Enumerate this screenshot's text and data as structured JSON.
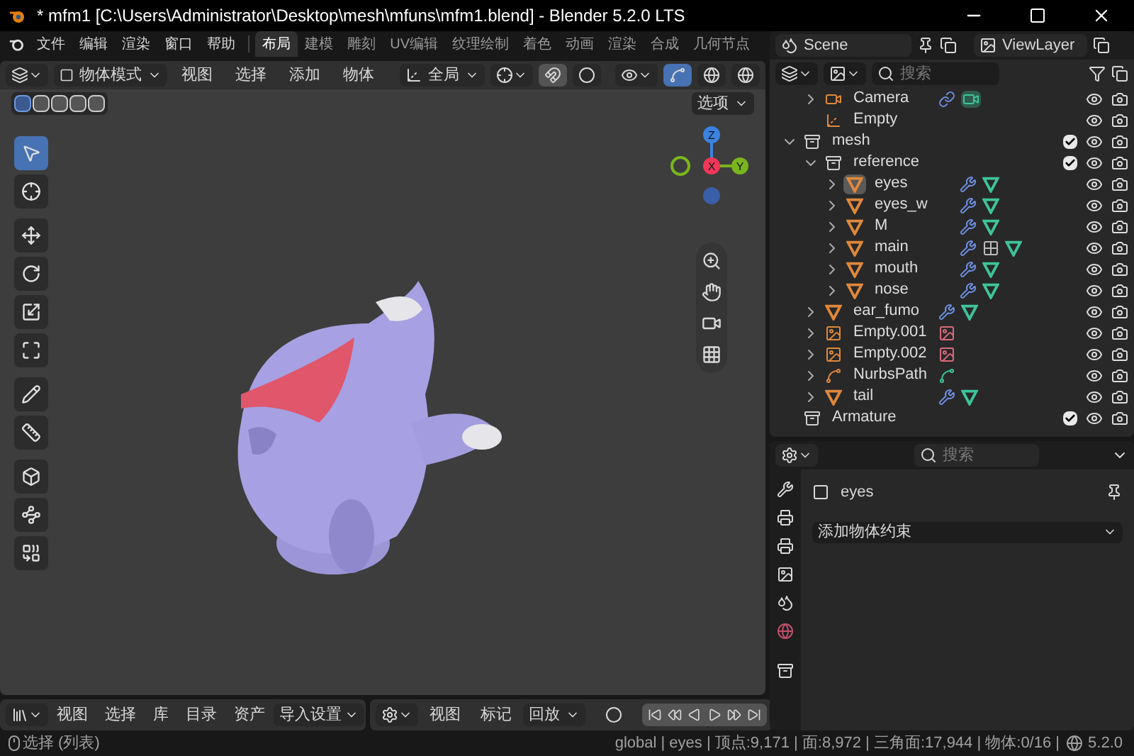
{
  "window": {
    "title": "* mfm1 [C:\\Users\\Administrator\\Desktop\\mesh\\mfuns\\mfm1.blend] - Blender 5.2.0 LTS"
  },
  "menu": [
    "文件",
    "编辑",
    "渲染",
    "窗口",
    "帮助"
  ],
  "workspaces": [
    {
      "label": "布局",
      "selected": true
    },
    {
      "label": "建模",
      "selected": false
    },
    {
      "label": "雕刻",
      "selected": false
    },
    {
      "label": "UV编辑",
      "selected": false
    },
    {
      "label": "纹理绘制",
      "selected": false
    },
    {
      "label": "着色",
      "selected": false
    },
    {
      "label": "动画",
      "selected": false
    },
    {
      "label": "渲染",
      "selected": false
    },
    {
      "label": "合成",
      "selected": false
    },
    {
      "label": "几何节点",
      "selected": false
    }
  ],
  "viewport_header": {
    "mode": "物体模式",
    "menus": [
      "视图",
      "选择",
      "添加",
      "物体"
    ],
    "orientation": "全局",
    "snap_on": false,
    "overlay_on": true
  },
  "viewport": {
    "options": "选项",
    "tools": [
      {
        "selected": true
      },
      {
        "selected": false
      },
      {
        "selected": false
      },
      {
        "selected": false
      },
      {
        "selected": false
      },
      {
        "selected": false
      },
      {
        "selected": false
      },
      {
        "selected": false
      },
      {
        "selected": false
      },
      {
        "selected": false
      },
      {
        "selected": false
      }
    ],
    "gizmo": {
      "x": "X",
      "y": "Y",
      "z": "Z"
    }
  },
  "outliner": {
    "scene": "Scene",
    "view_layer": "ViewLayer",
    "search": {
      "placeholder": "搜索"
    },
    "items": [
      {
        "name": "Camera",
        "kind": "camera",
        "expanded": false,
        "selected": false,
        "data": [
          {
            "kind": "constraint"
          },
          {
            "kind": "camera"
          }
        ]
      },
      {
        "name": "Empty",
        "kind": "empty",
        "selected": false
      },
      {
        "name": "mesh",
        "kind": "collection",
        "expanded": true,
        "checked": true,
        "selected": false,
        "children": [
          {
            "name": "reference",
            "kind": "collection",
            "expanded": true,
            "checked": true,
            "selected": false,
            "children": [
              {
                "name": "eyes",
                "kind": "mesh",
                "expanded": false,
                "selected": true,
                "data": [
                  {
                    "kind": "modifier"
                  },
                  {
                    "kind": "mesh"
                  }
                ]
              },
              {
                "name": "eyes_w",
                "kind": "mesh",
                "expanded": false,
                "selected": false,
                "data": [
                  {
                    "kind": "modifier"
                  },
                  {
                    "kind": "mesh"
                  }
                ]
              },
              {
                "name": "M",
                "kind": "mesh",
                "expanded": false,
                "selected": false,
                "data": [
                  {
                    "kind": "modifier"
                  },
                  {
                    "kind": "mesh"
                  }
                ]
              },
              {
                "name": "main",
                "kind": "mesh",
                "expanded": false,
                "selected": false,
                "data": [
                  {
                    "kind": "modifier"
                  },
                  {
                    "kind": "lattice"
                  },
                  {
                    "kind": "mesh"
                  }
                ]
              },
              {
                "name": "mouth",
                "kind": "mesh",
                "expanded": false,
                "selected": false,
                "data": [
                  {
                    "kind": "modifier"
                  },
                  {
                    "kind": "mesh"
                  }
                ]
              },
              {
                "name": "nose",
                "kind": "mesh",
                "expanded": false,
                "selected": false,
                "data": [
                  {
                    "kind": "modifier"
                  },
                  {
                    "kind": "mesh"
                  }
                ]
              }
            ]
          },
          {
            "name": "ear_fumo",
            "kind": "mesh",
            "expanded": false,
            "selected": false,
            "data": [
              {
                "kind": "modifier"
              },
              {
                "kind": "mesh"
              }
            ]
          },
          {
            "name": "Empty.001",
            "kind": "image",
            "expanded": false,
            "selected": false,
            "data": [
              {
                "kind": "image"
              }
            ]
          },
          {
            "name": "Empty.002",
            "kind": "image",
            "expanded": false,
            "selected": false,
            "data": [
              {
                "kind": "image"
              }
            ]
          },
          {
            "name": "NurbsPath",
            "kind": "curve",
            "expanded": false,
            "selected": false,
            "data": [
              {
                "kind": "curve"
              }
            ]
          },
          {
            "name": "tail",
            "kind": "mesh",
            "expanded": false,
            "selected": false,
            "data": [
              {
                "kind": "modifier"
              },
              {
                "kind": "mesh"
              }
            ]
          }
        ]
      },
      {
        "name": "Armature",
        "kind": "collection",
        "checked": true,
        "selected": false
      }
    ]
  },
  "properties": {
    "search": {
      "placeholder": "搜索"
    },
    "object": "eyes",
    "add_constraint": "添加物体约束"
  },
  "asset_header": {
    "menus": [
      "视图",
      "选择",
      "库",
      "目录",
      "资产"
    ],
    "import": "导入设置"
  },
  "timeline_header": {
    "menus": [
      "视图",
      "标记"
    ],
    "playback": "回放"
  },
  "status_bar": {
    "left": "选择 (列表)",
    "stats": "global | eyes | 顶点:9,171 | 面:8,972 | 三角面:17,944 | 物体:0/16 |",
    "version": "5.2.0"
  }
}
